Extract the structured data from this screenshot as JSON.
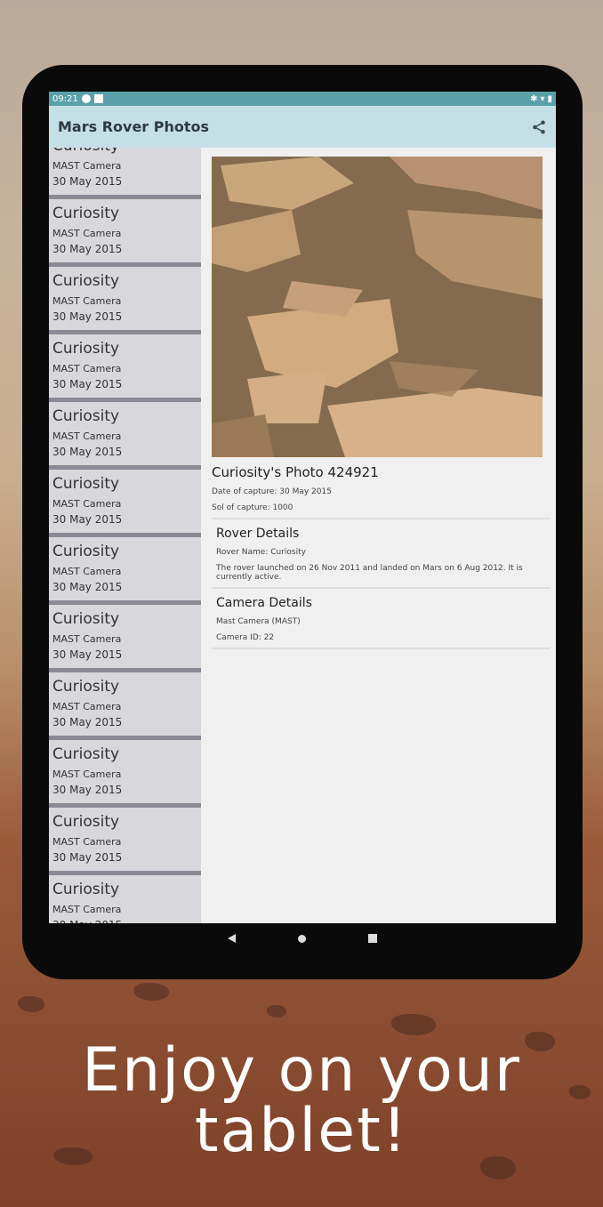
{
  "status_bar": {
    "time": "09:21"
  },
  "appbar": {
    "title": "Mars Rover Photos",
    "share_icon": "share-icon"
  },
  "list": {
    "items": [
      {
        "name": "Curiosity",
        "camera": "MAST Camera",
        "date": "30 May 2015"
      },
      {
        "name": "Curiosity",
        "camera": "MAST Camera",
        "date": "30 May 2015"
      },
      {
        "name": "Curiosity",
        "camera": "MAST Camera",
        "date": "30 May 2015"
      },
      {
        "name": "Curiosity",
        "camera": "MAST Camera",
        "date": "30 May 2015"
      },
      {
        "name": "Curiosity",
        "camera": "MAST Camera",
        "date": "30 May 2015"
      },
      {
        "name": "Curiosity",
        "camera": "MAST Camera",
        "date": "30 May 2015"
      },
      {
        "name": "Curiosity",
        "camera": "MAST Camera",
        "date": "30 May 2015"
      },
      {
        "name": "Curiosity",
        "camera": "MAST Camera",
        "date": "30 May 2015"
      },
      {
        "name": "Curiosity",
        "camera": "MAST Camera",
        "date": "30 May 2015"
      },
      {
        "name": "Curiosity",
        "camera": "MAST Camera",
        "date": "30 May 2015"
      },
      {
        "name": "Curiosity",
        "camera": "MAST Camera",
        "date": "30 May 2015"
      },
      {
        "name": "Curiosity",
        "camera": "MAST Camera",
        "date": "30 May 2015"
      }
    ]
  },
  "detail": {
    "photo_title": "Curiosity's Photo 424921",
    "date_of_capture": "Date of capture: 30 May 2015",
    "sol_of_capture": "Sol of capture: 1000",
    "rover_section_title": "Rover Details",
    "rover_name": "Rover Name: Curiosity",
    "rover_description": "The rover launched on 26 Nov 2011 and landed on Mars on 6 Aug 2012. It is currently active.",
    "camera_section_title": "Camera Details",
    "camera_name": "Mast Camera (MAST)",
    "camera_id": "Camera ID: 22"
  },
  "caption": {
    "line1": "Enjoy on your",
    "line2": "tablet!"
  },
  "colors": {
    "status_bar": "#5aa0a9",
    "appbar": "#c5dfe6",
    "list_bg": "#d8d8dc"
  }
}
